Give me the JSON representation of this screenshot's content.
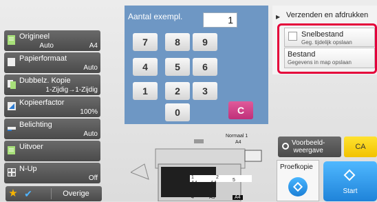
{
  "keypad": {
    "count_label": "Aantal exempl.",
    "count_value": "1",
    "keys": [
      "7",
      "8",
      "9",
      "4",
      "5",
      "6",
      "1",
      "2",
      "3",
      "0",
      "C"
    ]
  },
  "right_panel": {
    "title": "Verzenden en afdrukken",
    "options": [
      {
        "title": "Snelbestand",
        "subtitle": "Geg. tijdelijk opslaan"
      },
      {
        "title": "Bestand",
        "subtitle": "Gegevens in map opslaan"
      }
    ]
  },
  "menu": [
    {
      "label": "Origineel",
      "value_left": "Auto",
      "value": "A4",
      "icon": "original-icon"
    },
    {
      "label": "Papierformaat",
      "value": "Auto",
      "icon": "paper-size-icon"
    },
    {
      "label": "Dubbelz. Kopie",
      "value": "1-Zijdig→1-Zijdig",
      "icon": "duplex-icon"
    },
    {
      "label": "Kopieerfactor",
      "value": "100%",
      "icon": "copy-ratio-icon"
    },
    {
      "label": "Belichting",
      "value": "Auto",
      "icon": "exposure-icon"
    },
    {
      "label": "Uitvoer",
      "value": "",
      "icon": "output-icon"
    },
    {
      "label": "N-Up",
      "value": "Off",
      "icon": "n-up-icon"
    }
  ],
  "bottom_bar": {
    "other_label": "Overige"
  },
  "preview": {
    "label_line1": "Voorbeeld-",
    "label_line2": "weergave"
  },
  "ca_label": "CA",
  "proof": {
    "label": "Proefkopie"
  },
  "start": {
    "label": "Start"
  },
  "machine": {
    "output_label_1": "Normaal 1",
    "output_label_2": "A4",
    "trays": [
      {
        "num": "1",
        "size": "A4",
        "num2": "2",
        "size2": "A4",
        "num3": "5"
      },
      {
        "num": "3",
        "size": "B4"
      },
      {
        "num": "4",
        "size": "A3",
        "size2": "A4"
      }
    ]
  }
}
